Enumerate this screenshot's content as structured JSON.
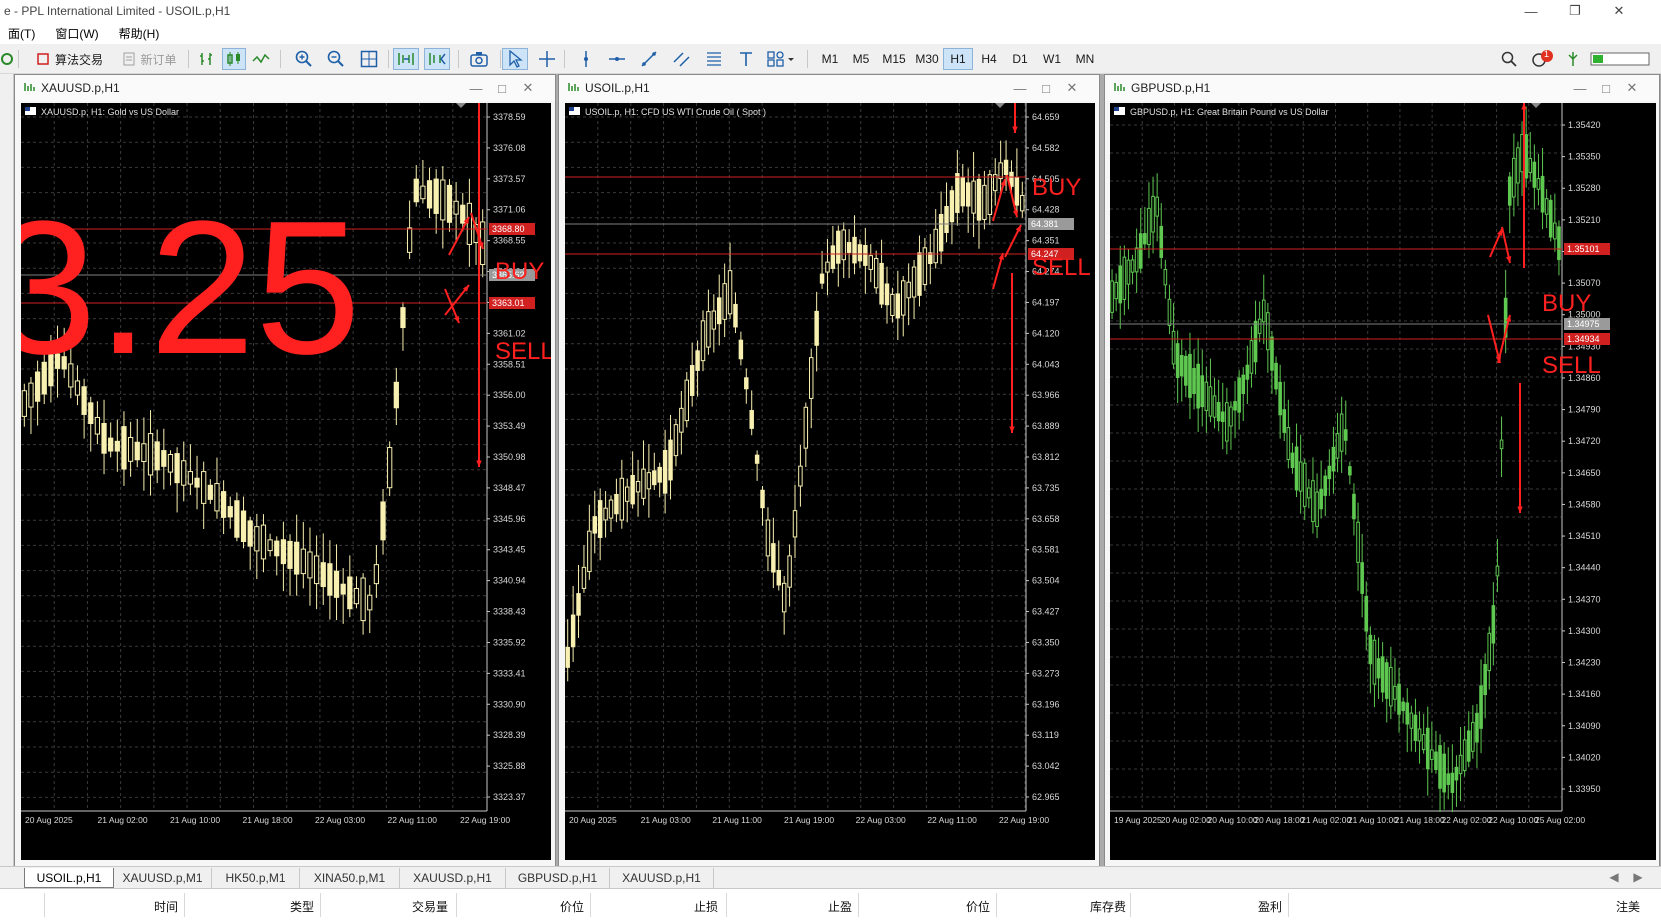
{
  "window": {
    "title": "e - PPL International Limited - USOIL.p,H1",
    "min_icon": "minimize-icon",
    "max_icon": "restore-icon",
    "close_icon": "close-icon"
  },
  "menu": [
    "面(T)",
    "窗口(W)",
    "帮助(H)"
  ],
  "toolbar": {
    "algo_trading": "算法交易",
    "new_order": "新订单",
    "timeframes": [
      "M1",
      "M5",
      "M15",
      "M30",
      "H1",
      "H4",
      "D1",
      "W1",
      "MN"
    ],
    "active_timeframe": "H1",
    "notification_count": "1"
  },
  "charts": [
    {
      "id": "xauusd",
      "window_title": "XAUUSD.p,H1",
      "info": "XAUUSD.p, H1:  Gold vs US Dollar",
      "price_labels": [
        "3378.59",
        "3376.08",
        "3373.57",
        "3371.06",
        "3368.55",
        "3366.04",
        "3363.53",
        "3361.02",
        "3358.51",
        "3356.00",
        "3353.49",
        "3350.98",
        "3348.47",
        "3345.96",
        "3343.45",
        "3340.94",
        "3338.43",
        "3335.92",
        "3333.41",
        "3330.90",
        "3328.39",
        "3325.88",
        "3323.37"
      ],
      "time_labels": [
        "20 Aug 2025",
        "21 Aug 02:00",
        "21 Aug 10:00",
        "21 Aug 18:00",
        "22 Aug 03:00",
        "22 Aug 11:00",
        "22 Aug 19:00"
      ],
      "hline_labels": [
        "3368.80",
        "3365.62",
        "3363.01"
      ],
      "overlay_text": "3.25",
      "buy_label": "BUY",
      "sell_label": "SELL",
      "candle_color": "#f8f0b0"
    },
    {
      "id": "usoil",
      "window_title": "USOIL.p,H1",
      "info": "USOIL.p, H1:  CFD US WTI Crude Oil ( Spot )",
      "price_labels": [
        "64.659",
        "64.582",
        "64.505",
        "64.428",
        "64.351",
        "64.274",
        "64.197",
        "64.120",
        "64.043",
        "63.966",
        "63.889",
        "63.812",
        "63.735",
        "63.658",
        "63.581",
        "63.504",
        "63.427",
        "63.350",
        "63.273",
        "63.196",
        "63.119",
        "63.042",
        "62.965"
      ],
      "time_labels": [
        "20 Aug 2025",
        "21 Aug 03:00",
        "21 Aug 11:00",
        "21 Aug 19:00",
        "22 Aug 03:00",
        "22 Aug 11:00",
        "22 Aug 19:00"
      ],
      "hline_labels": [
        "64.381",
        "64.247"
      ],
      "buy_label": "BUY",
      "sell_label": "SELL",
      "candle_color": "#f8f0b0"
    },
    {
      "id": "gbpusd",
      "window_title": "GBPUSD.p,H1",
      "info": "GBPUSD.p, H1:  Great Britain Pound vs US Dollar",
      "price_labels": [
        "1.35420",
        "1.35350",
        "1.35280",
        "1.35210",
        "1.35140",
        "1.35070",
        "1.35000",
        "1.34930",
        "1.34860",
        "1.34790",
        "1.34720",
        "1.34650",
        "1.34580",
        "1.34510",
        "1.34440",
        "1.34370",
        "1.34300",
        "1.34230",
        "1.34160",
        "1.34090",
        "1.34020",
        "1.33950"
      ],
      "time_labels": [
        "19 Aug 2025",
        "20 Aug 02:00",
        "20 Aug 10:00",
        "20 Aug 18:00",
        "21 Aug 02:00",
        "21 Aug 10:00",
        "21 Aug 18:00",
        "22 Aug 02:00",
        "22 Aug 10:00",
        "25 Aug 02:00"
      ],
      "hline_labels": [
        "1.35101",
        "1.34975",
        "1.34934"
      ],
      "buy_label": "BUY",
      "sell_label": "SELL",
      "candle_color": "#5ec850"
    }
  ],
  "tabs": [
    "USOIL.p,H1",
    "XAUUSD.p,M1",
    "HK50.p,M1",
    "XINA50.p,M1",
    "XAUUSD.p,H1",
    "GBPUSD.p,H1",
    "XAUUSD.p,H1"
  ],
  "active_tab": "USOIL.p,H1",
  "trade_columns": [
    "时间",
    "类型",
    "交易量",
    "价位",
    "止损",
    "止盈",
    "价位",
    "库存费",
    "盈利",
    "注美"
  ],
  "colors": {
    "grid": "#3a3a3a",
    "annotation_red": "#ff2020",
    "hline_red": "#d02020",
    "hline_gray": "#808080"
  }
}
